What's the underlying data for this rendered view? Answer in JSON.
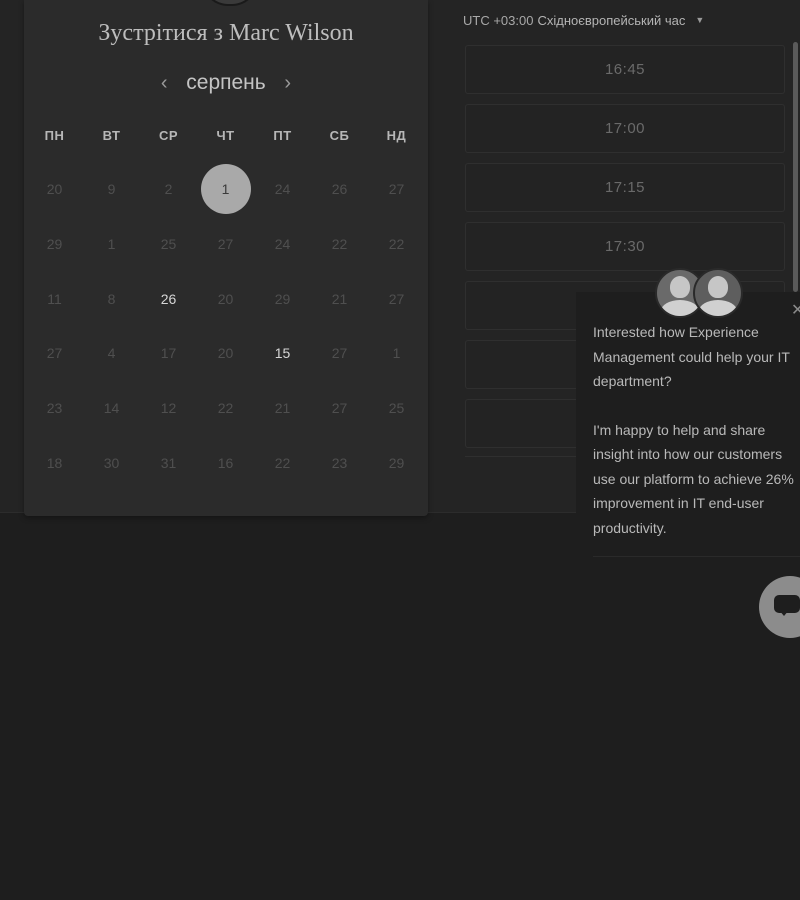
{
  "meeting": {
    "title": "Зустрітися з Marc Wilson"
  },
  "calendar": {
    "month": "серпень",
    "prev_icon": "chevron-left-icon",
    "next_icon": "chevron-right-icon",
    "weekdays": [
      "ПН",
      "ВТ",
      "СР",
      "ЧТ",
      "ПТ",
      "СБ",
      "НД"
    ],
    "days": [
      "20",
      "9",
      "2",
      "1",
      "24",
      "26",
      "27",
      "29",
      "1",
      "25",
      "27",
      "24",
      "22",
      "22",
      "11",
      "8",
      "26",
      "20",
      "29",
      "21",
      "27",
      "27",
      "4",
      "17",
      "20",
      "15",
      "27",
      "1",
      "23",
      "14",
      "12",
      "22",
      "21",
      "27",
      "25",
      "18",
      "30",
      "31",
      "16",
      "22",
      "23",
      "29"
    ],
    "selected_index": 3,
    "bright_indices": [
      16,
      25
    ]
  },
  "timezone": {
    "offset": "UTC +03:00",
    "name": "Східноєвропейський час"
  },
  "slots": [
    "16:45",
    "17:00",
    "17:15",
    "17:30",
    "",
    "",
    ""
  ],
  "chat": {
    "message_1": "Interested how Experience Management could help your IT department?",
    "message_2": "I'm happy to help and share insight into how our customers use our platform to achieve 26% improvement in IT end-user productivity.",
    "close_icon": "close-icon",
    "fab_icon": "chat-bubble-icon"
  }
}
